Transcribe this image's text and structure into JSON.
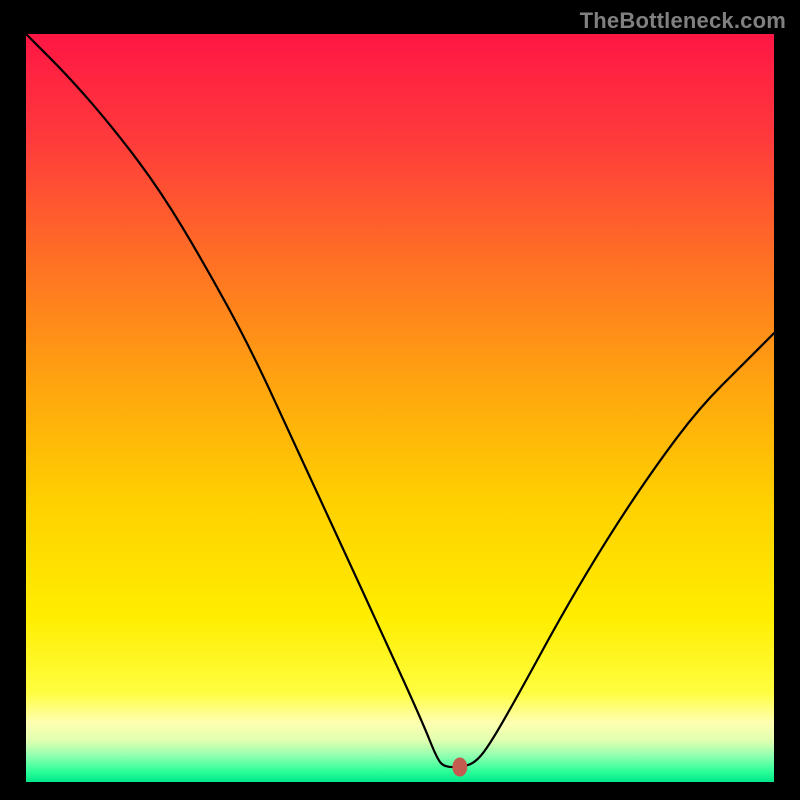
{
  "watermark": "TheBottleneck.com",
  "chart_data": {
    "type": "line",
    "title": "",
    "xlabel": "",
    "ylabel": "",
    "xlim": [
      0,
      100
    ],
    "ylim": [
      0,
      100
    ],
    "background": {
      "top_color": "#ff1644",
      "upper_mid_color": "#ff7a1d",
      "mid_color": "#ffe400",
      "lower_band_color": "#ffffa0",
      "bottom_color": "#00ff80"
    },
    "marker": {
      "x": 58,
      "y": 2,
      "color": "#c45b50"
    },
    "series": [
      {
        "name": "curve",
        "color": "#000000",
        "points": [
          {
            "x": 0,
            "y": 100
          },
          {
            "x": 6,
            "y": 94
          },
          {
            "x": 12,
            "y": 87
          },
          {
            "x": 18,
            "y": 79
          },
          {
            "x": 24,
            "y": 69
          },
          {
            "x": 30,
            "y": 58
          },
          {
            "x": 36,
            "y": 45
          },
          {
            "x": 42,
            "y": 32
          },
          {
            "x": 48,
            "y": 19
          },
          {
            "x": 53,
            "y": 8
          },
          {
            "x": 55,
            "y": 3
          },
          {
            "x": 56,
            "y": 2
          },
          {
            "x": 58,
            "y": 2
          },
          {
            "x": 60,
            "y": 2.5
          },
          {
            "x": 62,
            "y": 5
          },
          {
            "x": 66,
            "y": 12
          },
          {
            "x": 72,
            "y": 23
          },
          {
            "x": 78,
            "y": 33
          },
          {
            "x": 84,
            "y": 42
          },
          {
            "x": 90,
            "y": 50
          },
          {
            "x": 96,
            "y": 56
          },
          {
            "x": 100,
            "y": 60
          }
        ]
      }
    ]
  }
}
